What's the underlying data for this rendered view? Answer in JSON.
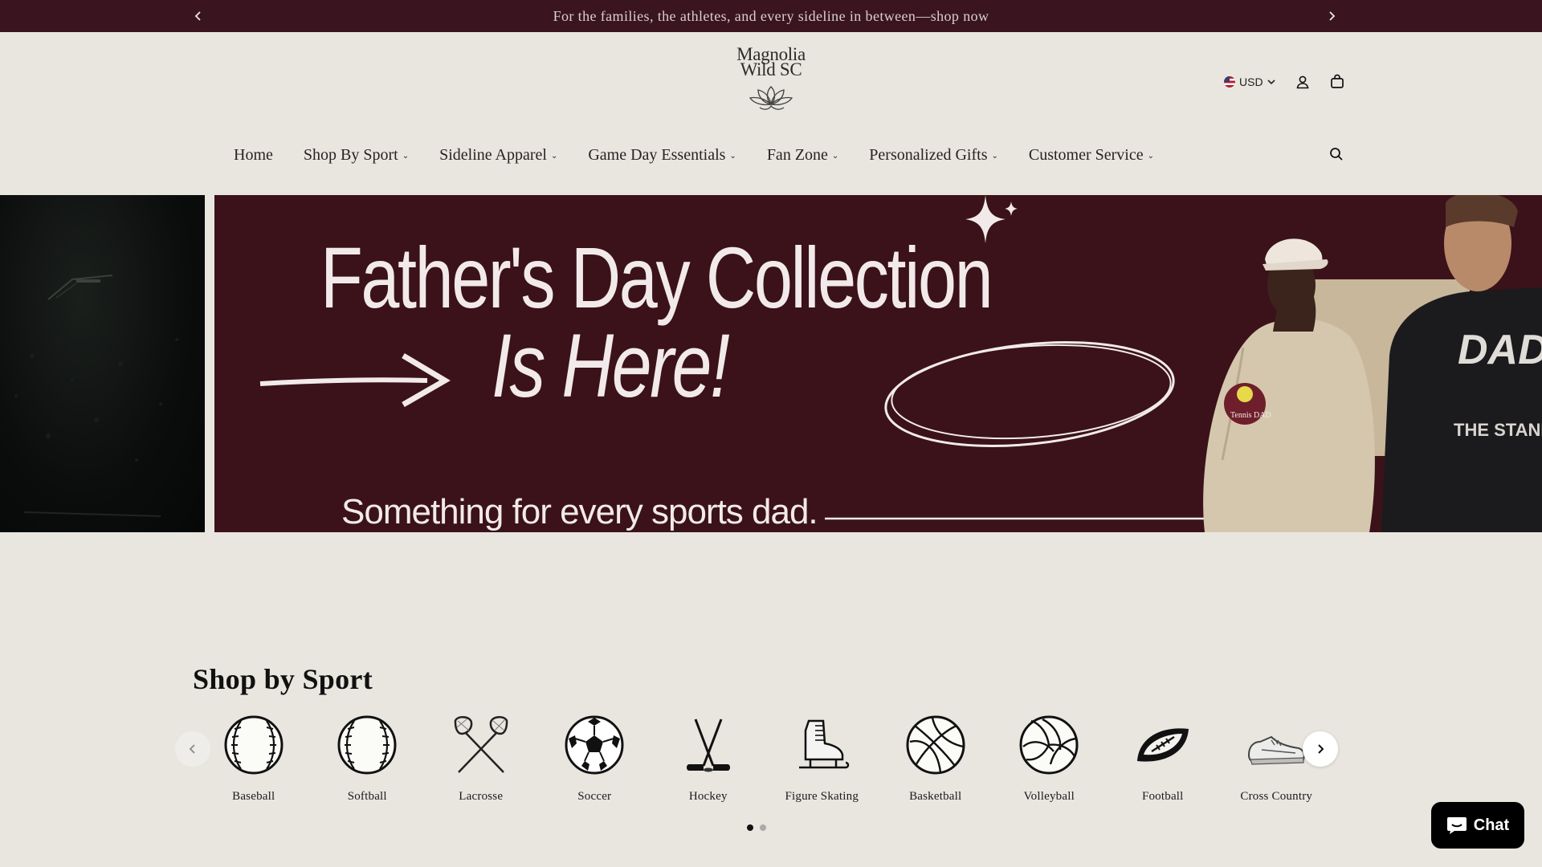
{
  "announcement": {
    "text": "For the families, the athletes, and every sideline in between—shop now",
    "prev_icon": "chevron-left-icon",
    "next_icon": "chevron-right-icon"
  },
  "header": {
    "logo_line1": "Magnolia",
    "logo_line2": "Wild SC",
    "currency": "USD",
    "icons": [
      "us-flag-icon",
      "chevron-down-icon",
      "account-icon",
      "cart-icon",
      "search-icon"
    ]
  },
  "nav": {
    "items": [
      {
        "label": "Home",
        "has_menu": false
      },
      {
        "label": "Shop By Sport",
        "has_menu": true
      },
      {
        "label": "Sideline Apparel",
        "has_menu": true
      },
      {
        "label": "Game Day Essentials",
        "has_menu": true
      },
      {
        "label": "Fan Zone",
        "has_menu": true
      },
      {
        "label": "Personalized Gifts",
        "has_menu": true
      },
      {
        "label": "Customer Service",
        "has_menu": true
      }
    ]
  },
  "hero": {
    "title_line1": "Father's Day Collection",
    "title_line2": "Is Here!",
    "subtitle": "Something for every sports dad.",
    "hoodie_print": "Tennis DAD",
    "shirt_print_1": "DAD",
    "shirt_print_2": "THE STANDARD",
    "colors": {
      "background": "#3b1219",
      "text": "#f2eaea"
    }
  },
  "shop_by_sport": {
    "title": "Shop by Sport",
    "sports": [
      {
        "label": "Baseball",
        "icon": "baseball-icon"
      },
      {
        "label": "Softball",
        "icon": "softball-icon"
      },
      {
        "label": "Lacrosse",
        "icon": "lacrosse-icon"
      },
      {
        "label": "Soccer",
        "icon": "soccer-ball-icon"
      },
      {
        "label": "Hockey",
        "icon": "hockey-sticks-icon"
      },
      {
        "label": "Figure Skating",
        "icon": "ice-skate-icon"
      },
      {
        "label": "Basketball",
        "icon": "basketball-icon"
      },
      {
        "label": "Volleyball",
        "icon": "volleyball-icon"
      },
      {
        "label": "Football",
        "icon": "football-icon"
      },
      {
        "label": "Cross Country",
        "icon": "running-shoe-icon"
      }
    ],
    "pages": 2,
    "active_page": 1
  },
  "chat": {
    "label": "Chat",
    "icon": "chat-bubble-icon"
  },
  "colors": {
    "announcement_bg": "#3a1520",
    "page_bg": "#e9e6df"
  }
}
